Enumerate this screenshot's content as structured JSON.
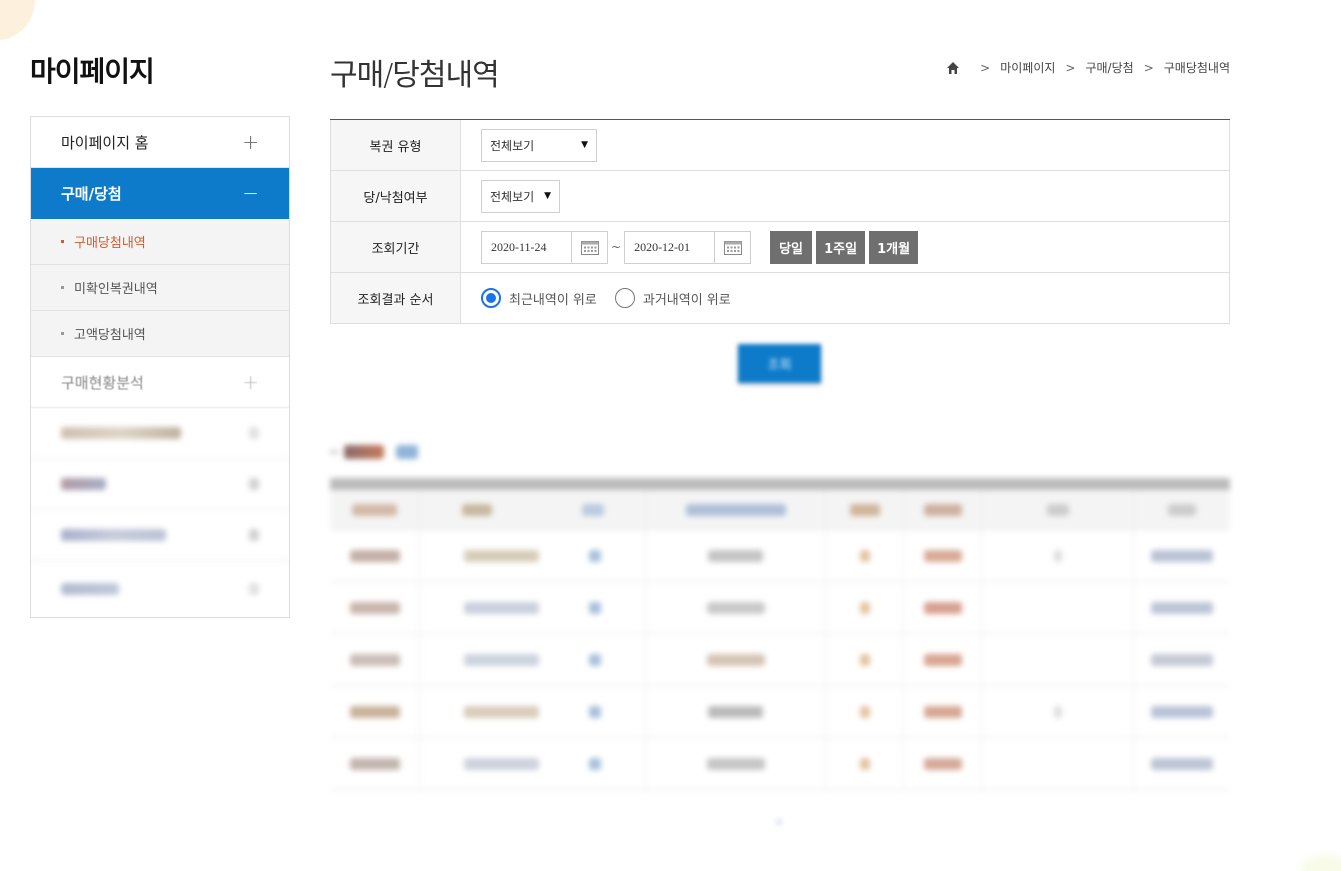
{
  "sidebar": {
    "title": "마이페이지",
    "items": [
      {
        "label": "마이페이지 홈",
        "sign": "+"
      },
      {
        "label": "구매/당첨",
        "sign": "−"
      }
    ],
    "subitems": [
      {
        "label": "구매당첨내역"
      },
      {
        "label": "미확인복권내역"
      },
      {
        "label": "고액당첨내역"
      }
    ],
    "faded_item": {
      "label": "구매현황분석",
      "sign": "+"
    }
  },
  "header": {
    "title": "구매/당첨",
    "title_suffix": "내역",
    "breadcrumb": [
      "마이페이지",
      "구매/당첨",
      "구매당첨내역"
    ]
  },
  "search": {
    "rows": [
      {
        "label": "복권 유형"
      },
      {
        "label": "당/낙첨여부"
      },
      {
        "label": "조회기간"
      },
      {
        "label": "조회결과 순서"
      }
    ],
    "lottery_type": "전체보기",
    "win_status": "전체보기",
    "start_date": "2020-11-24",
    "end_date": "2020-12-01",
    "tilde": "~",
    "quick_buttons": [
      "당일",
      "1주일",
      "1개월"
    ],
    "order_options": [
      "최근내역이 위로",
      "과거내역이 위로"
    ],
    "order_selected": 0,
    "submit_label": "조회"
  },
  "colors": {
    "accent_blue": "#0d7bc9",
    "current_sub": "#d85a2b",
    "quick_button": "#6f6f6f",
    "radio_checked": "#1a73e8"
  }
}
